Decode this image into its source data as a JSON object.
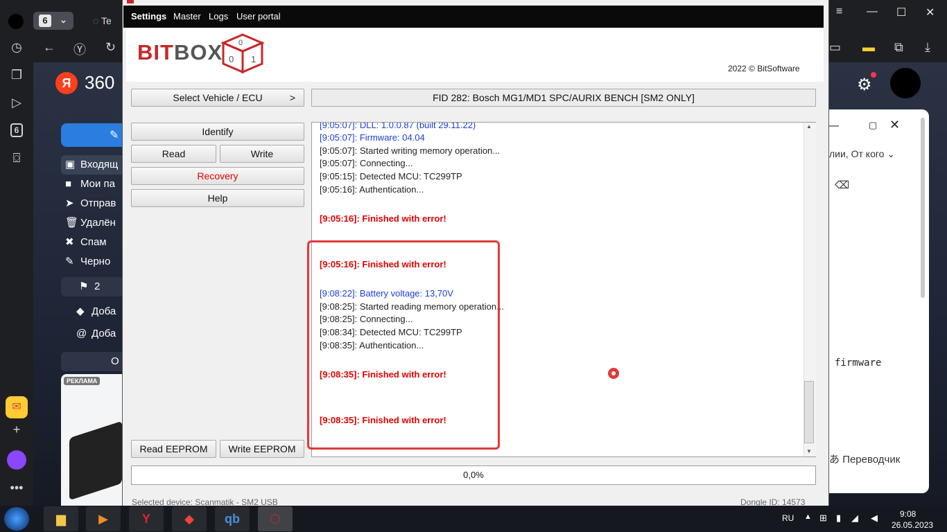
{
  "browser": {
    "tab_count": "6",
    "tab_title_fragment": "Te",
    "brand_fragment": "360",
    "side_tab_count": "6"
  },
  "mail": {
    "folders": [
      {
        "icon": "inbox-icon",
        "glyph": "▣",
        "label": "Входящ"
      },
      {
        "icon": "folder-icon",
        "glyph": "■",
        "label": "Мои па"
      },
      {
        "icon": "send-icon",
        "glyph": "➤",
        "label": "Отправ"
      },
      {
        "icon": "trash-icon",
        "glyph": "🗑",
        "label": "Удалён"
      },
      {
        "icon": "spam-icon",
        "glyph": "✖",
        "label": "Спам"
      },
      {
        "icon": "draft-icon",
        "glyph": "✎",
        "label": "Черно"
      }
    ],
    "bookmark_count": "2",
    "actions": [
      {
        "glyph": "◆",
        "label": "Доба"
      },
      {
        "glyph": "@",
        "label": "Доба"
      }
    ],
    "more_fragment": "О",
    "ad_label": "РЕКЛАМА"
  },
  "right_panel": {
    "filter_text": "лии, От кого",
    "firmware_text": "firmware",
    "translator_text": "Переводчик"
  },
  "bitbox": {
    "menu": [
      "Settings",
      "Master",
      "Logs",
      "User portal"
    ],
    "logo_prefix": "BIT",
    "logo_suffix": "BOX",
    "copyright": "2022 © BitSoftware",
    "select_vehicle_label": "Select Vehicle / ECU",
    "select_arrow": ">",
    "fid_label": "FID 282: Bosch MG1/MD1 SPC/AURIX BENCH [SM2 ONLY]",
    "buttons": {
      "identify": "Identify",
      "read": "Read",
      "write": "Write",
      "recovery": "Recovery",
      "help": "Help",
      "read_eeprom": "Read EEPROM",
      "write_eeprom": "Write EEPROM"
    },
    "log_lines": [
      {
        "text": "[9:05:07]: DLL: 1.0.0.87 (built 29.11.22)",
        "style": "blue"
      },
      {
        "text": "[9:05:07]: Firmware: 04.04",
        "style": "blue"
      },
      {
        "text": "[9:05:07]: Started writing memory operation...",
        "style": "normal"
      },
      {
        "text": "[9:05:07]: Connecting...",
        "style": "normal"
      },
      {
        "text": "[9:05:15]: Detected MCU: TC299TP",
        "style": "normal"
      },
      {
        "text": "[9:05:16]: Authentication...",
        "style": "normal"
      },
      {
        "text": "[9:05:16]: Finished with error!",
        "style": "err"
      },
      {
        "text": "[9:05:16]: Finished with error!",
        "style": "err"
      },
      {
        "text": "[9:08:22]: Battery voltage:  13,70V",
        "style": "blue"
      },
      {
        "text": "[9:08:25]: Started reading memory operation...",
        "style": "normal"
      },
      {
        "text": "[9:08:25]: Connecting...",
        "style": "normal"
      },
      {
        "text": "[9:08:34]: Detected MCU: TC299TP",
        "style": "normal"
      },
      {
        "text": "[9:08:35]: Authentication...",
        "style": "normal"
      },
      {
        "text": "[9:08:35]: Finished with error!",
        "style": "err"
      },
      {
        "text": "[9:08:35]: Finished with error!",
        "style": "err"
      }
    ],
    "progress": "0,0%",
    "status_device": "Selected device: Scanmatik - SM2 USB",
    "status_dongle": "Dongle ID: 14573"
  },
  "taskbar": {
    "apps": [
      "folder-app",
      "media-app",
      "yandex-app",
      "anydesk-app",
      "qbittorrent-app",
      "bitbox-app"
    ],
    "lang": "RU",
    "time": "9:08",
    "date": "26.05.2023"
  },
  "colors": {
    "log_blue": "#1c3fd6",
    "log_error": "#e00000",
    "highlight": "#e03a3a",
    "logo_red": "#c62828"
  }
}
